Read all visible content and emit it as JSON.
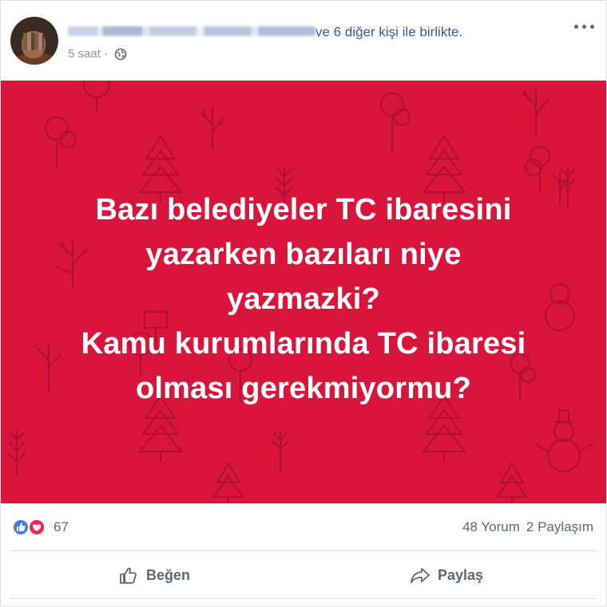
{
  "post": {
    "author_suffix": "ve 6 diğer kişi ile birlikte.",
    "time": "5 saat",
    "time_separator": "·",
    "icons": {
      "privacy": "globe-icon",
      "more": "more-options-icon"
    }
  },
  "content": {
    "background_color": "#d9153c",
    "lines": [
      "Bazı belediyeler TC ibaresini",
      "yazarken bazıları niye",
      "yazmazki?",
      "Kamu kurumlarında TC ibaresi",
      "olması gerekmiyormu?"
    ]
  },
  "stats": {
    "reaction_icons": [
      "like-reaction-icon",
      "love-reaction-icon"
    ],
    "reaction_count": "67",
    "comments": "48 Yorum",
    "shares": "2 Paylaşım"
  },
  "actions": {
    "like": "Beğen",
    "share": "Paylaş"
  },
  "colors": {
    "link": "#385898",
    "muted": "#606770",
    "like_blue": "#4a79e6",
    "love_red": "#f0284a"
  }
}
